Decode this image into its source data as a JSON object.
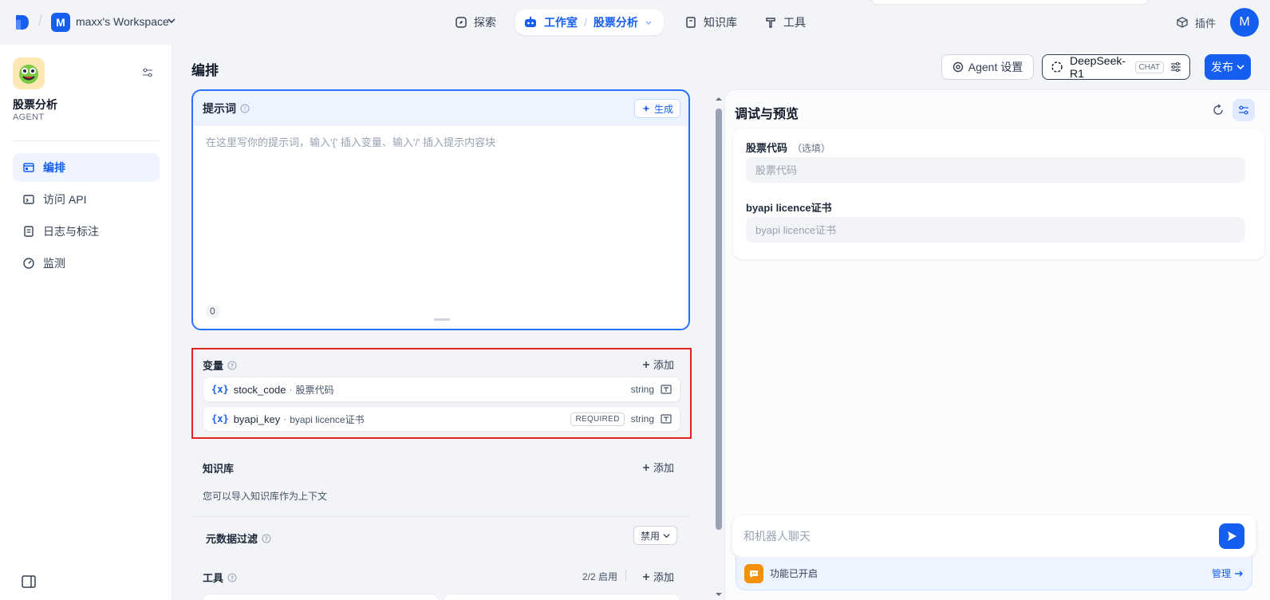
{
  "topbar": {
    "workspace_initial": "M",
    "workspace_name": "maxx's Workspace",
    "nav_explore": "探索",
    "nav_studio": "工作室",
    "nav_app": "股票分析",
    "nav_knowledge": "知识库",
    "nav_tools": "工具",
    "nav_plugins": "插件",
    "user_initial": "M"
  },
  "sidebar": {
    "app_name": "股票分析",
    "app_type": "AGENT",
    "items": [
      {
        "label": "编排",
        "icon": "layout-icon",
        "active": true
      },
      {
        "label": "访问 API",
        "icon": "terminal-icon",
        "active": false
      },
      {
        "label": "日志与标注",
        "icon": "document-icon",
        "active": false
      },
      {
        "label": "监测",
        "icon": "gauge-icon",
        "active": false
      }
    ]
  },
  "header": {
    "title": "编排",
    "agent_settings": "Agent 设置",
    "model_name": "DeepSeek-R1",
    "model_badge": "CHAT",
    "publish": "发布"
  },
  "prompt": {
    "label": "提示词",
    "generate": "生成",
    "placeholder": "在这里写你的提示词，输入'{' 插入变量、输入'/' 插入提示内容块",
    "count": "0"
  },
  "variables": {
    "title": "变量",
    "add": "添加",
    "rows": [
      {
        "key": "stock_code",
        "sep": "·",
        "desc": "股票代码",
        "required": "",
        "type": "string"
      },
      {
        "key": "byapi_key",
        "sep": "·",
        "desc": "byapi licence证书",
        "required": "REQUIRED",
        "type": "string"
      }
    ]
  },
  "knowledge": {
    "title": "知识库",
    "add": "添加",
    "desc": "您可以导入知识库作为上下文",
    "meta_filter": "元数据过滤",
    "meta_value": "禁用"
  },
  "tools": {
    "title": "工具",
    "status": "2/2 启用",
    "add": "添加"
  },
  "debug": {
    "title": "调试与预览",
    "fields": [
      {
        "label": "股票代码",
        "optional": "（选填）",
        "placeholder": "股票代码"
      },
      {
        "label": "byapi licence证书",
        "optional": "",
        "placeholder": "byapi licence证书"
      }
    ],
    "chat_placeholder": "和机器人聊天",
    "feature_text": "功能已开启",
    "manage": "管理"
  },
  "colors": {
    "accent": "#155eef",
    "highlight": "#e02424",
    "feature": "#f79009"
  }
}
